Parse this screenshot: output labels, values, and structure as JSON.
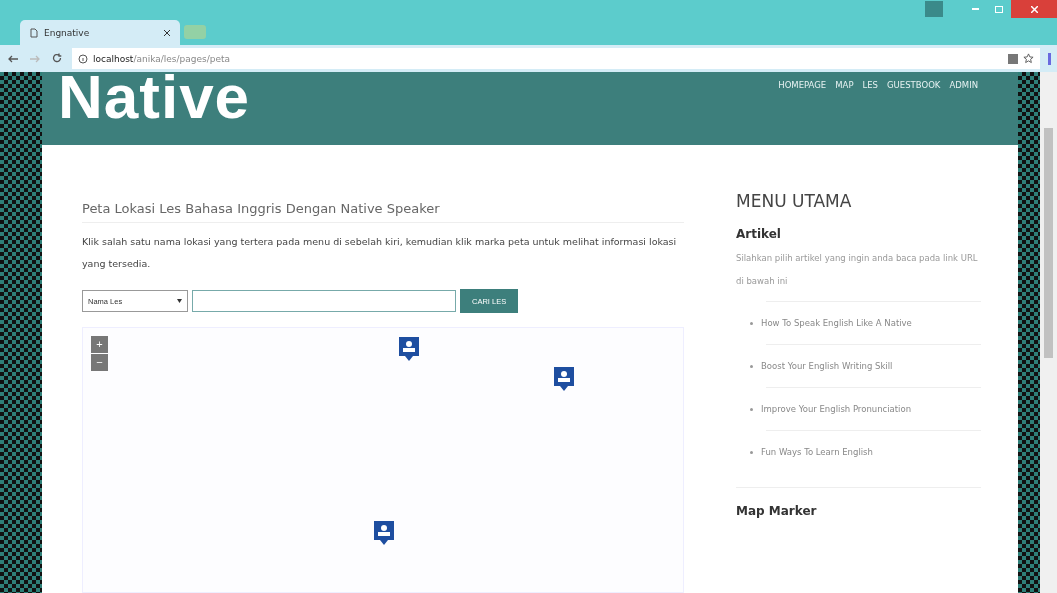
{
  "browser": {
    "tab_title": "Engnative",
    "url_host": "localhost",
    "url_path": "/anika/les/pages/peta"
  },
  "site": {
    "logo": "Native",
    "nav": [
      {
        "label": "HOMEPAGE"
      },
      {
        "label": "MAP"
      },
      {
        "label": "LES"
      },
      {
        "label": "GUESTBOOK"
      },
      {
        "label": "ADMIN"
      }
    ]
  },
  "main": {
    "heading": "Peta Lokasi Les Bahasa Inggris Dengan Native Speaker",
    "intro": "Klik salah satu nama lokasi yang tertera pada menu di sebelah kiri, kemudian klik marka peta untuk melihat informasi lokasi yang tersedia.",
    "select_value": "Nama Les",
    "search_button": "CARI LES",
    "zoom_in": "+",
    "zoom_out": "−"
  },
  "sidebar": {
    "title": "MENU UTAMA",
    "sections": [
      {
        "title": "Artikel",
        "text": "Silahkan pilih artikel yang ingin anda baca pada link URL di bawah ini",
        "links": [
          "How To Speak English Like A Native",
          "Boost Your English Writing Skill",
          "Improve Your English Pronunciation",
          "Fun Ways To Learn English"
        ]
      },
      {
        "title": "Map Marker"
      }
    ]
  }
}
